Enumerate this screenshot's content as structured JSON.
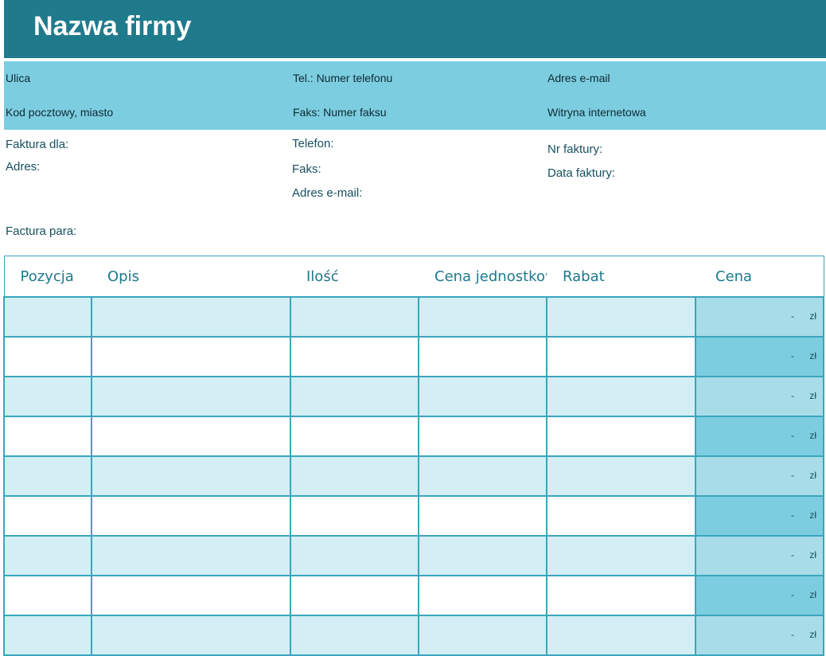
{
  "company": {
    "name": "Nazwa firmy"
  },
  "contact": {
    "street": "Ulica",
    "postal_city": "Kod pocztowy, miasto",
    "tel": "Tel.: Numer telefonu",
    "fax": "Faks: Numer faksu",
    "email": "Adres e-mail",
    "website": "Witryna internetowa"
  },
  "billing": {
    "invoice_for": "Faktura dla:",
    "address": "Adres:",
    "phone": "Telefon:",
    "fax": "Faks:",
    "email": "Adres e-mail:",
    "invoice_no": "Nr faktury:",
    "invoice_date": "Data faktury:",
    "factura_para": "Factura para:"
  },
  "table": {
    "headers": [
      "Pozycja",
      "Opis",
      "Ilość",
      "Cena jednostkowa",
      "Rabat",
      "Cena"
    ],
    "rows": [
      {
        "price_dash": "-",
        "currency": "zł"
      },
      {
        "price_dash": "-",
        "currency": "zł"
      },
      {
        "price_dash": "-",
        "currency": "zł"
      },
      {
        "price_dash": "-",
        "currency": "zł"
      },
      {
        "price_dash": "-",
        "currency": "zł"
      },
      {
        "price_dash": "-",
        "currency": "zł"
      },
      {
        "price_dash": "-",
        "currency": "zł"
      },
      {
        "price_dash": "-",
        "currency": "zł"
      },
      {
        "price_dash": "-",
        "currency": "zł"
      }
    ]
  },
  "colors": {
    "header_bg": "#1f7a8c",
    "contact_bg": "#7ccde0",
    "row_light": "#d3eef5",
    "price_dark": "#7ccde0",
    "price_light": "#a8dce9"
  }
}
